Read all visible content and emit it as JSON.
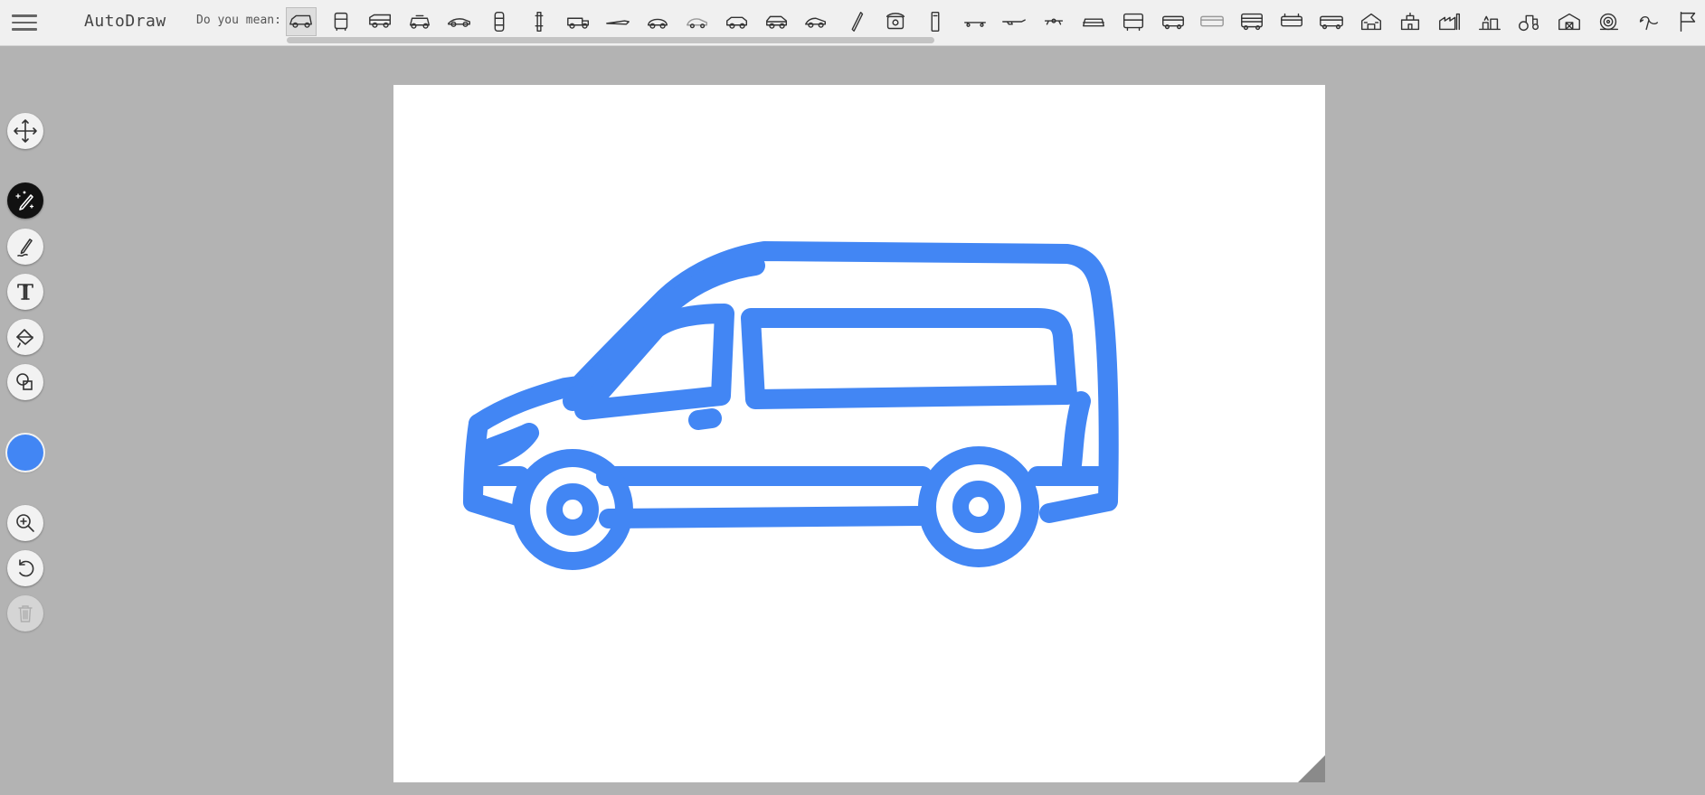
{
  "app": {
    "title": "AutoDraw"
  },
  "suggestions": {
    "label": "Do you mean:",
    "items": [
      "van-icon",
      "bus-front-icon",
      "minivan-icon",
      "taxi-icon",
      "sports-car-icon",
      "car-top-icon",
      "race-car-top-icon",
      "truck-icon",
      "speedboat-icon",
      "beetle-icon",
      "compact-car-icon",
      "sedan-icon",
      "hatchback-icon",
      "coupe-icon",
      "ski-icon",
      "telephone-icon",
      "phone-icon",
      "skateboard-icon",
      "rifle-icon",
      "drone-icon",
      "train-icon",
      "bus-icon",
      "tram-icon",
      "coach-icon",
      "double-decker-icon",
      "trolley-icon",
      "city-bus-icon",
      "house-icon",
      "school-icon",
      "factory-icon",
      "farm-icon",
      "tractor-icon",
      "barn-icon",
      "snail-icon",
      "duck-icon",
      "flag-icon"
    ],
    "selected_index": 0
  },
  "tools": [
    {
      "name": "select-tool",
      "icon": "move-arrows-icon"
    },
    {
      "name": "autodraw-tool",
      "icon": "magic-pencil-icon",
      "active": true
    },
    {
      "name": "draw-tool",
      "icon": "pencil-icon"
    },
    {
      "name": "type-tool",
      "icon": "text-icon"
    },
    {
      "name": "fill-tool",
      "icon": "paint-bucket-icon"
    },
    {
      "name": "shape-tool",
      "icon": "shapes-icon"
    },
    {
      "name": "zoom-tool",
      "icon": "zoom-in-icon"
    },
    {
      "name": "undo-tool",
      "icon": "undo-icon"
    },
    {
      "name": "delete-tool",
      "icon": "trash-icon",
      "disabled": true
    }
  ],
  "colors": {
    "current": "#4286f4",
    "topbar": "#f0f0f0",
    "workspace": "#b3b3b3",
    "canvas": "#ffffff"
  },
  "canvas": {
    "drawing": "van-drawing"
  }
}
